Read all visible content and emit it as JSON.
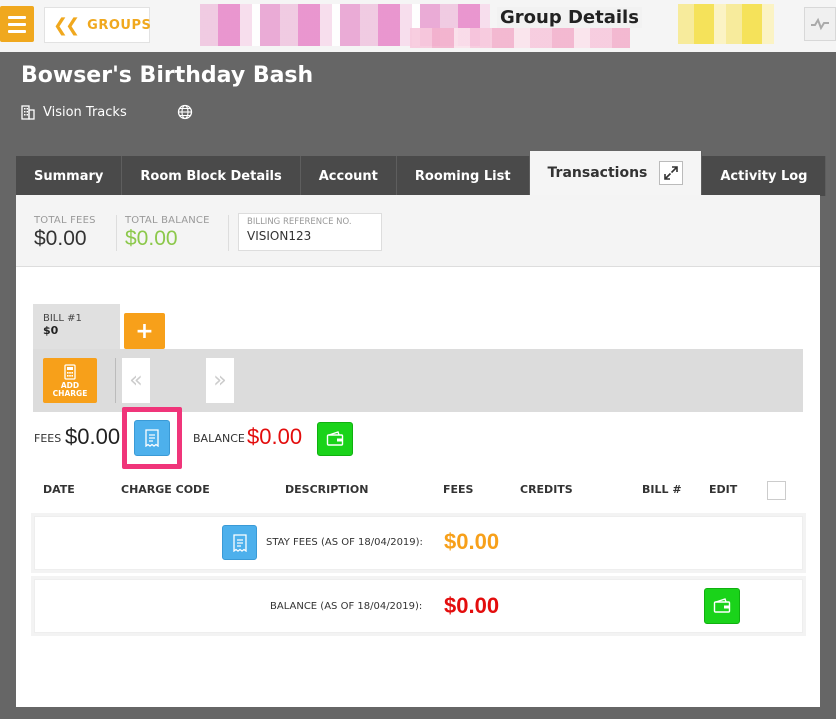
{
  "topbar": {
    "back_label": "GROUPS",
    "title": "Group Details"
  },
  "group": {
    "name": "Bowser's Birthday Bash",
    "property": "Vision Tracks"
  },
  "tabs": [
    {
      "label": "Summary"
    },
    {
      "label": "Room Block Details"
    },
    {
      "label": "Account"
    },
    {
      "label": "Rooming List"
    },
    {
      "label": "Transactions",
      "active": true
    },
    {
      "label": "Activity Log"
    }
  ],
  "summary": {
    "total_fees_label": "TOTAL FEES",
    "total_fees": "$0.00",
    "total_balance_label": "TOTAL BALANCE",
    "total_balance": "$0.00",
    "billing_ref_label": "BILLING REFERENCE NO.",
    "billing_ref": "VISION123"
  },
  "bill": {
    "name": "BILL #1",
    "amount": "$0",
    "add_charge_line1": "ADD",
    "add_charge_line2": "CHARGE",
    "fees_label": "FEES",
    "fees": "$0.00",
    "balance_label": "BALANCE",
    "balance": "$0.00"
  },
  "table": {
    "headers": [
      "DATE",
      "CHARGE CODE",
      "DESCRIPTION",
      "FEES",
      "CREDITS",
      "BILL #",
      "EDIT"
    ],
    "rows": [
      {
        "label": "STAY FEES (AS OF 18/04/2019):",
        "amount": "$0.00"
      },
      {
        "label": "BALANCE (AS OF 18/04/2019):",
        "amount": "$0.00"
      }
    ]
  },
  "colors": {
    "accent": "#f7a01a",
    "balance_red": "#e30d0d",
    "positive_green": "#8cc84b",
    "highlight": "#f0357a",
    "info_blue": "#4db0ec",
    "wallet_green": "#1ad31a"
  }
}
